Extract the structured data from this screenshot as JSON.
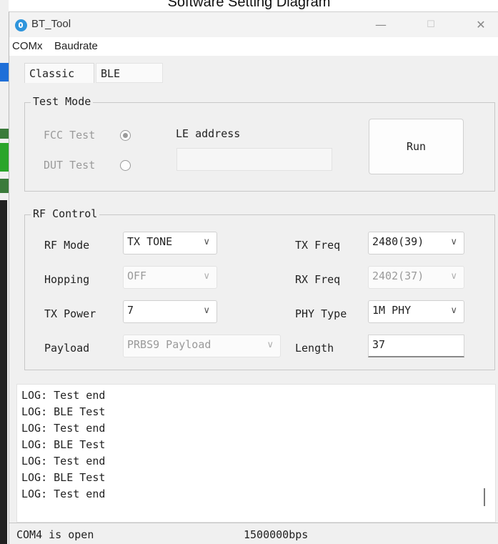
{
  "caption": "Software Setting Diagram",
  "window": {
    "title": "BT_Tool",
    "minimize_glyph": "—",
    "maximize_glyph": "☐",
    "close_glyph": "✕",
    "app_icon": "bluetooth-app-icon"
  },
  "menu": [
    "COMx",
    "Baudrate"
  ],
  "tabs": {
    "classic": "Classic",
    "ble": "BLE"
  },
  "test_mode": {
    "title": "Test Mode",
    "fcc_label": "FCC Test",
    "dut_label": "DUT Test",
    "le_address_label": "LE address",
    "le_address_value": "",
    "run_label": "Run"
  },
  "rf_control": {
    "title": "RF Control",
    "rf_mode_label": "RF Mode",
    "rf_mode_value": "TX TONE",
    "hopping_label": "Hopping",
    "hopping_value": "OFF",
    "tx_power_label": "TX Power",
    "tx_power_value": "7",
    "payload_label": "Payload",
    "payload_value": "PRBS9 Payload",
    "tx_freq_label": "TX Freq",
    "tx_freq_value": "2480(39)",
    "rx_freq_label": "RX Freq",
    "rx_freq_value": "2402(37)",
    "phy_type_label": "PHY Type",
    "phy_type_value": "1M PHY",
    "length_label": "Length",
    "length_value": "37",
    "chevron": "∨"
  },
  "log": [
    "LOG: Test end",
    "LOG: BLE Test",
    "LOG: Test end",
    "LOG: BLE Test",
    "LOG: Test end",
    "LOG: BLE Test",
    "LOG: Test end"
  ],
  "status": {
    "port": "COM4 is open",
    "baud": "1500000bps"
  },
  "colors": {
    "window_bg": "#f0f0f0",
    "accent": "#2f95dc",
    "disabled_text": "#9a9a9a"
  }
}
